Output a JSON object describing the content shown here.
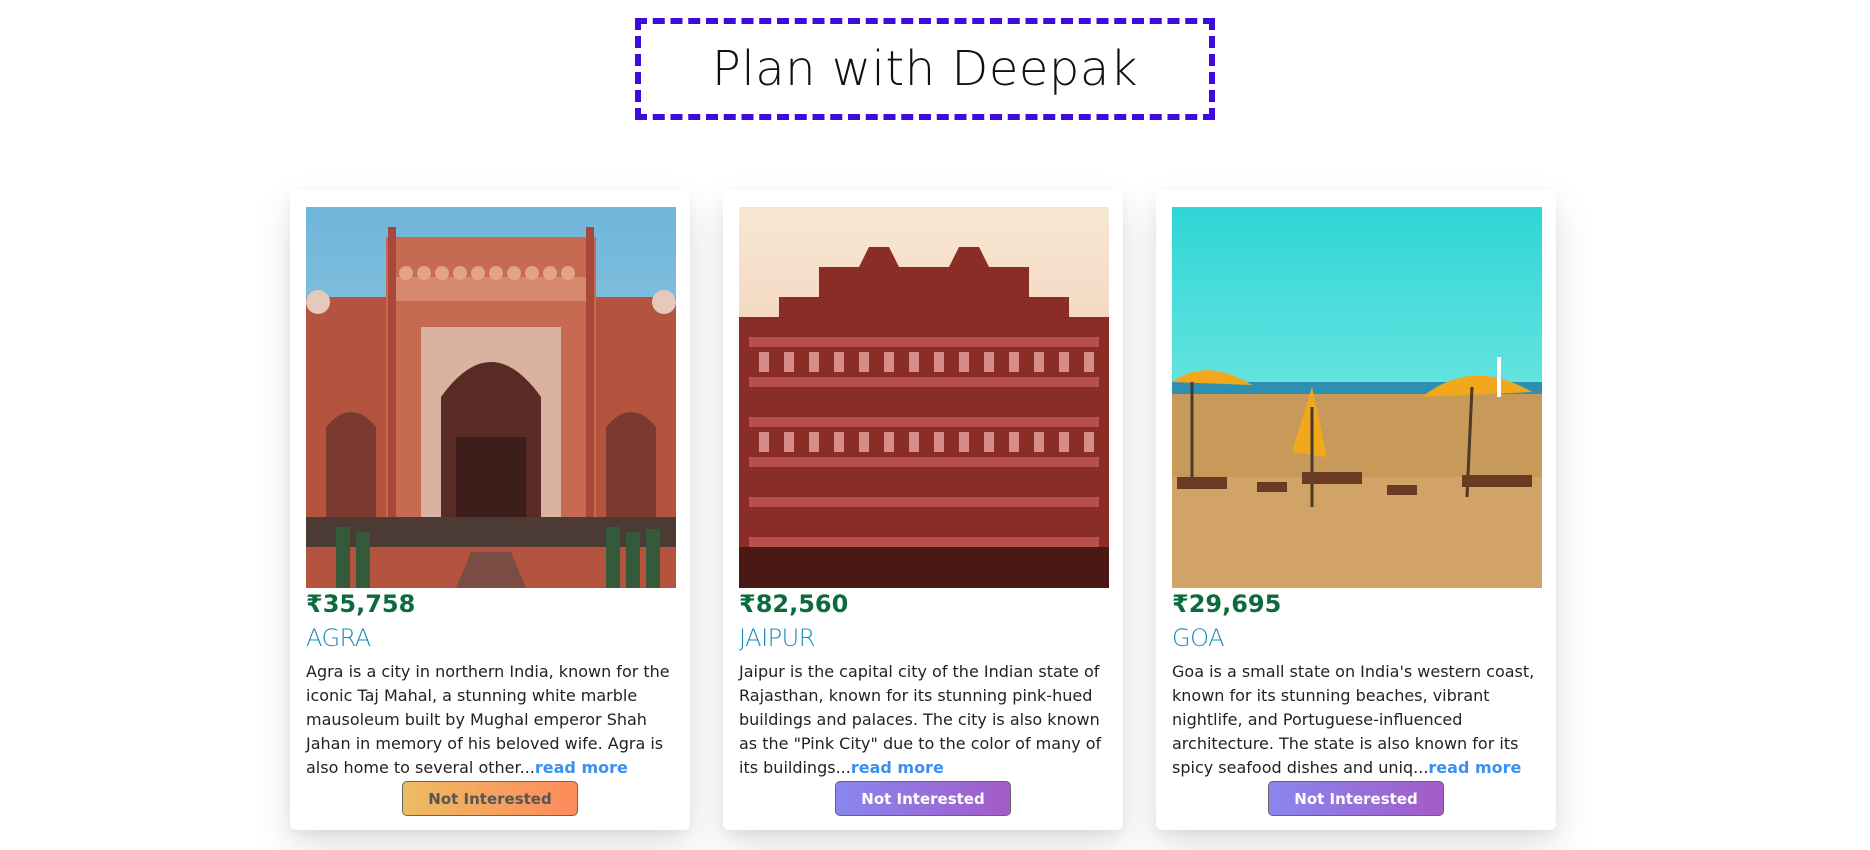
{
  "header": {
    "title": "Plan with Deepak"
  },
  "cards": [
    {
      "price": "₹35,758",
      "city": "AGRA",
      "description": "Agra is a city in northern India, known for the iconic Taj Mahal, a stunning white marble mausoleum built by Mughal emperor Shah Jahan in memory of his beloved wife. Agra is also home to several other...",
      "read_more": "read more",
      "button": "Not Interested",
      "image": "agra-monument-image"
    },
    {
      "price": "₹82,560",
      "city": "JAIPUR",
      "description": "Jaipur is the capital city of the Indian state of Rajasthan, known for its stunning pink-hued buildings and palaces. The city is also known as the \"Pink City\" due to the color of many of its buildings...",
      "read_more": "read more",
      "button": "Not Interested",
      "image": "jaipur-palace-image"
    },
    {
      "price": "₹29,695",
      "city": "GOA",
      "description": "Goa is a small state on India's western coast, known for its stunning beaches, vibrant nightlife, and Portuguese-influenced architecture. The state is also known for its spicy seafood dishes and uniq...",
      "read_more": "read more",
      "button": "Not Interested",
      "image": "goa-beach-image"
    }
  ],
  "colors": {
    "title_border": "#3f0bdc",
    "price": "#0b6b3b",
    "city": "#1a8ab8",
    "read_more": "#3b8ff0"
  }
}
